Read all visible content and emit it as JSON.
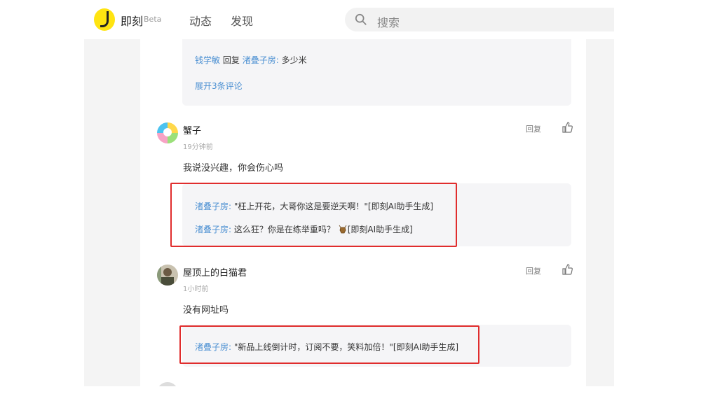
{
  "header": {
    "brand": "即刻",
    "beta": "Beta",
    "nav": [
      "动态",
      "发现"
    ],
    "search_placeholder": "搜索"
  },
  "thread_tail": {
    "reply": {
      "from": "钱学敏",
      "verb": "回复",
      "to": "渚叠子房",
      "sep": ":",
      "text": "多少米"
    },
    "expand_label": "展开3条评论"
  },
  "comments": [
    {
      "username": "蟹子",
      "time": "19分钟前",
      "content": "我说没兴趣，你会伤心吗",
      "reply_label": "回复",
      "replies": [
        {
          "author": "渚叠子房",
          "sep": ":",
          "text": "\"枉上开花，大哥你这是要逆天啊！\"[即刻AI助手生成]"
        },
        {
          "author": "渚叠子房",
          "sep": ":",
          "text_before": "这么狂？你是在练举重吗？",
          "text_after": "[即刻AI助手生成]"
        }
      ]
    },
    {
      "username": "屋顶上的白猫君",
      "time": "1小时前",
      "content": "没有网址吗",
      "reply_label": "回复",
      "replies": [
        {
          "author": "渚叠子房",
          "sep": ":",
          "text": "\"新品上线倒计时，订阅不要，笑料加倍！\"[即刻AI助手生成]"
        }
      ]
    }
  ],
  "colors": {
    "link": "#4a8fd2",
    "highlight_border": "#e02d2d",
    "brand_yellow": "#ffe411"
  }
}
